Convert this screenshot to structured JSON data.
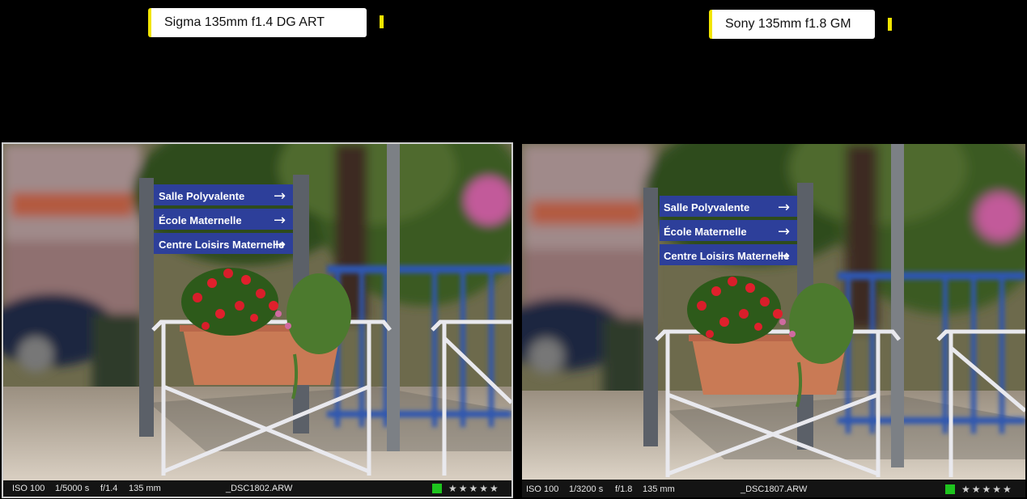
{
  "comparison": {
    "left": {
      "lens_label": "Sigma 135mm f1.4 DG ART",
      "sign": [
        "Salle Polyvalente",
        "École Maternelle",
        "Centre Loisirs Maternelle"
      ],
      "info": {
        "iso": "ISO 100",
        "shutter": "1/5000 s",
        "aperture": "f/1.4",
        "focal": "135 mm",
        "filename": "_DSC1802.ARW",
        "rating_stars": "★★★★★"
      },
      "active": true
    },
    "right": {
      "lens_label": "Sony 135mm f1.8 GM",
      "sign": [
        "Salle Polyvalente",
        "École Maternelle",
        "Centre Loisirs Maternelle"
      ],
      "info": {
        "iso": "ISO 100",
        "shutter": "1/3200 s",
        "aperture": "f/1.8",
        "focal": "135 mm",
        "filename": "_DSC1807.ARW",
        "rating_stars": "★★★★★"
      },
      "active": false
    }
  },
  "colors": {
    "accent_yellow": "#f2e500",
    "color_label_green": "#1ec41e",
    "sign_blue": "#2d3f9a",
    "rail_blue": "#2f56b0"
  }
}
